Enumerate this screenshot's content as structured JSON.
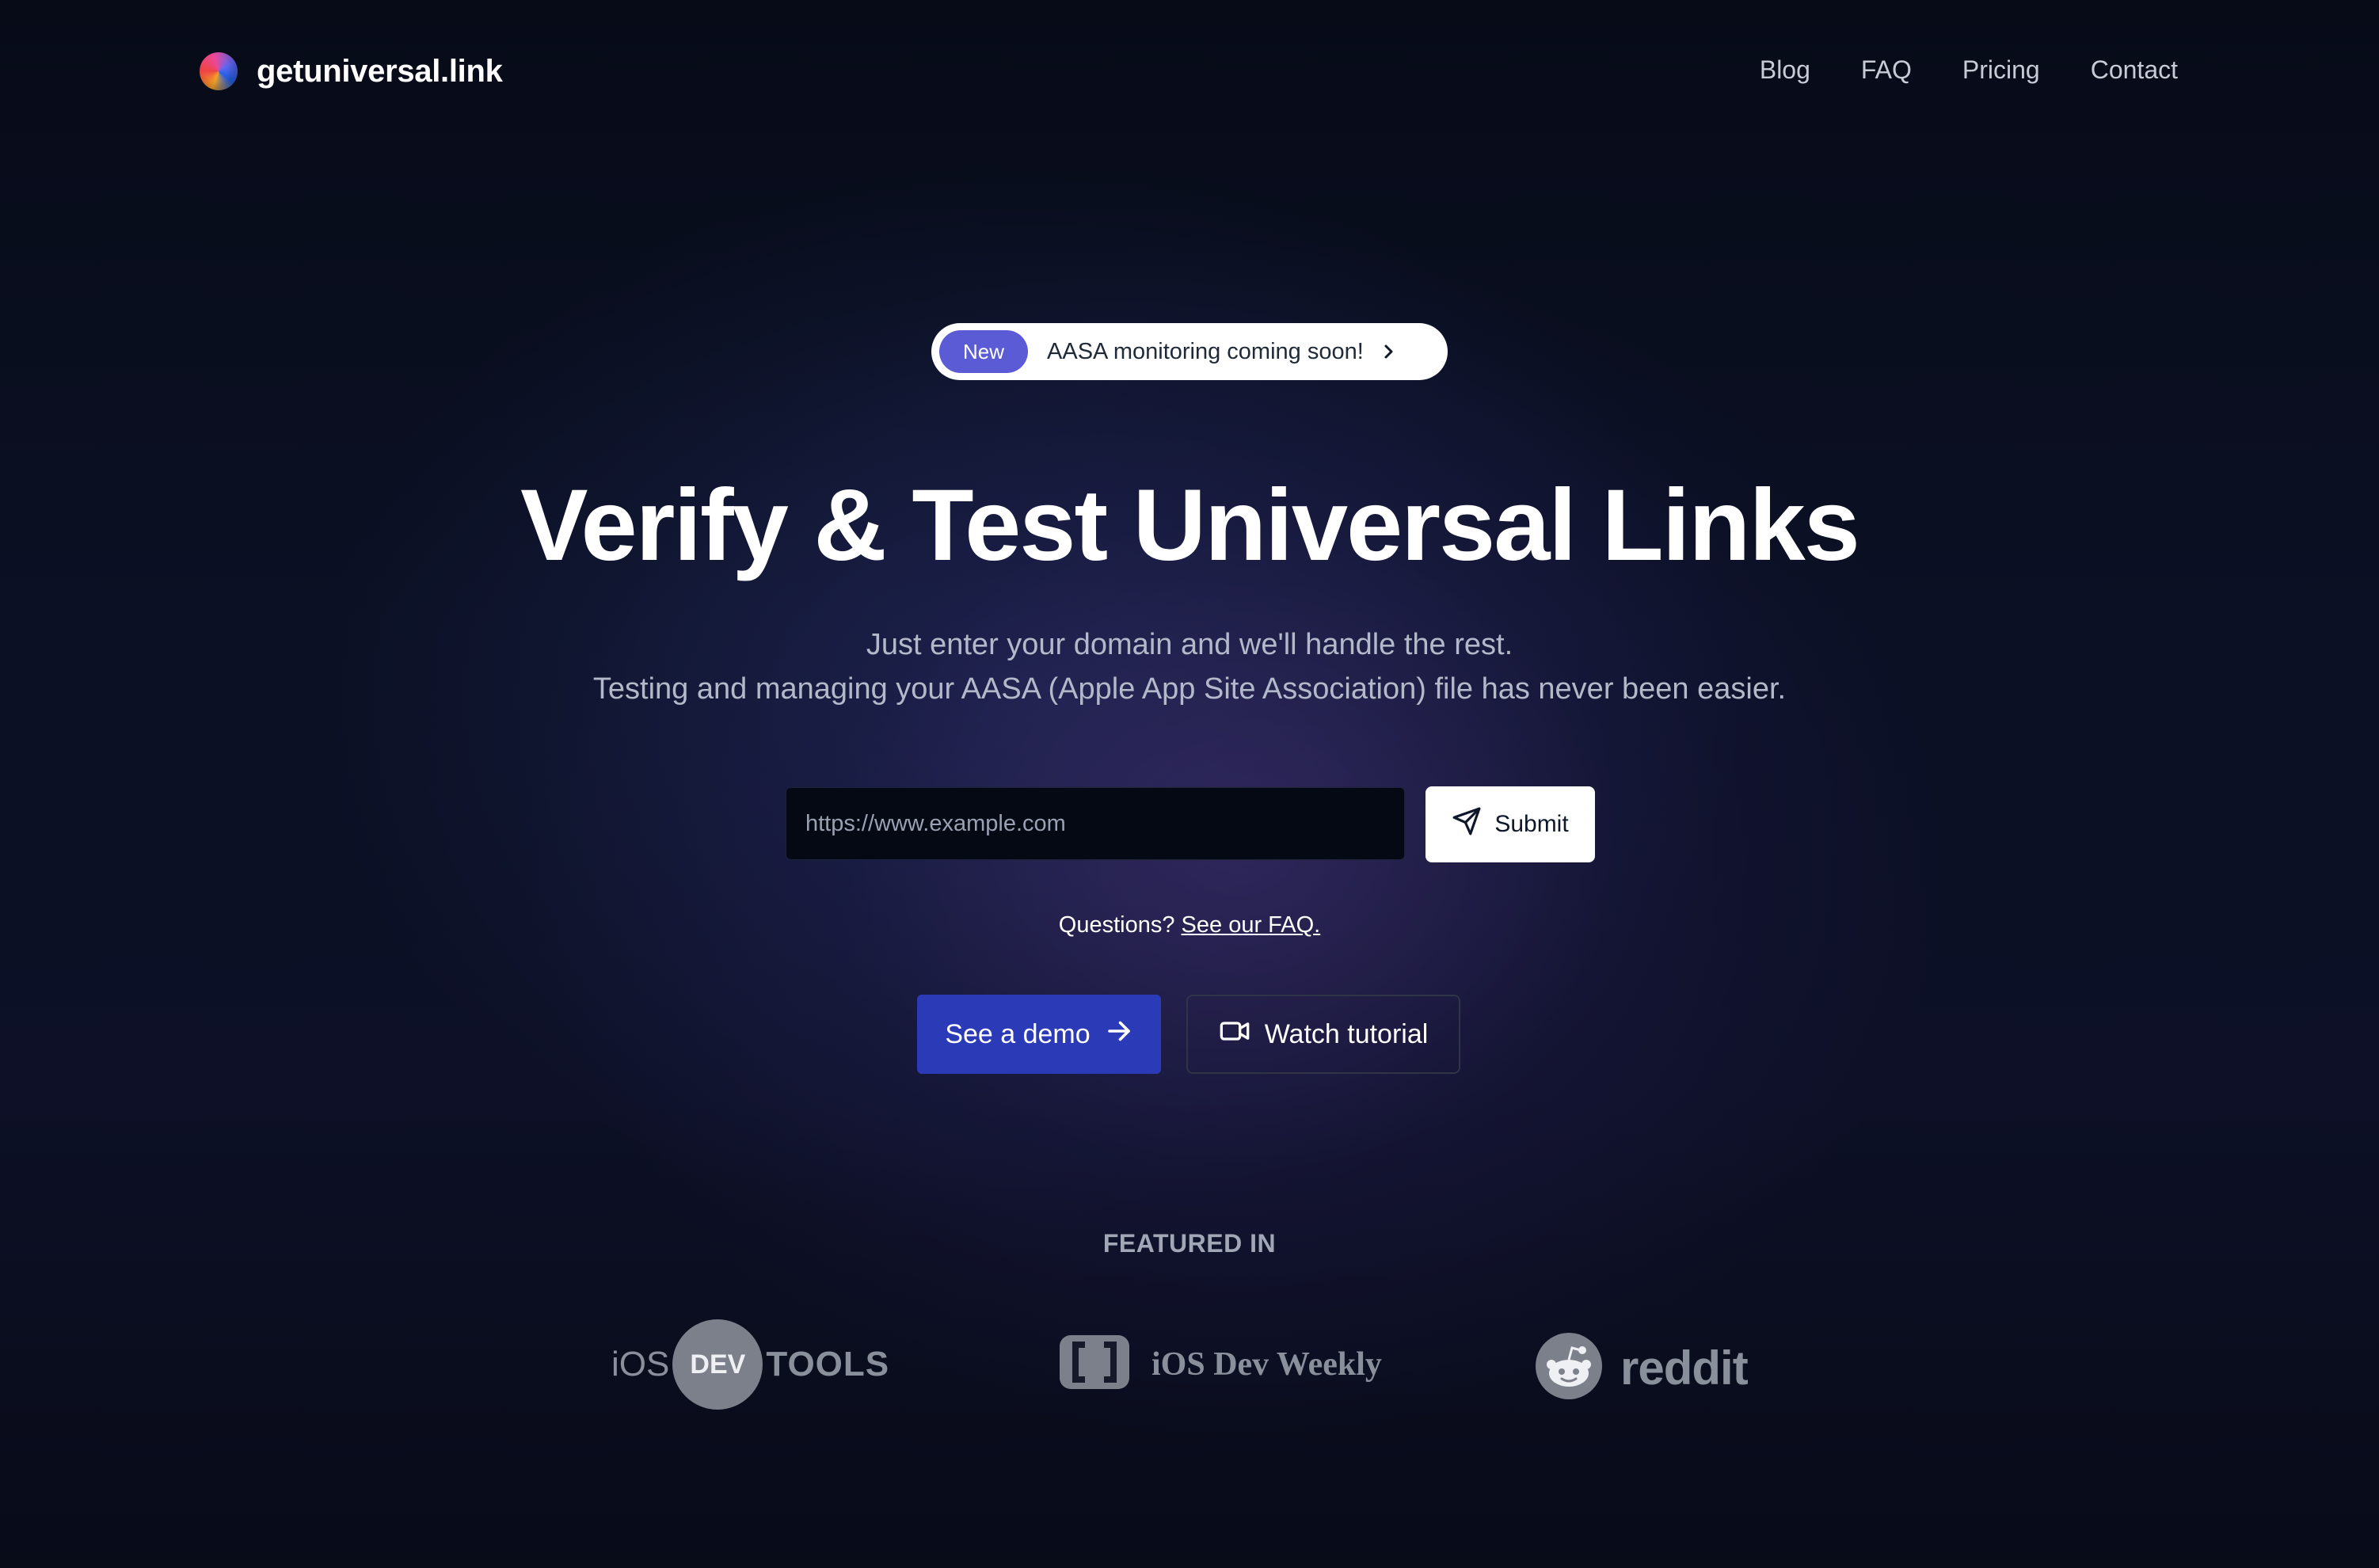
{
  "header": {
    "brand": "getuniversal.link",
    "nav": [
      {
        "label": "Blog"
      },
      {
        "label": "FAQ"
      },
      {
        "label": "Pricing"
      },
      {
        "label": "Contact"
      }
    ]
  },
  "announcement": {
    "badge": "New",
    "text": "AASA monitoring coming soon!"
  },
  "hero": {
    "title": "Verify & Test Universal Links",
    "subtitle_line1": "Just enter your domain and we'll handle the rest.",
    "subtitle_line2": "Testing and managing your AASA (Apple App Site Association) file has never been easier."
  },
  "form": {
    "url_placeholder": "https://www.example.com",
    "url_value": "",
    "submit_label": "Submit"
  },
  "faq": {
    "prefix": "Questions?",
    "link": "See our FAQ."
  },
  "cta": {
    "demo_label": "See a demo",
    "tutorial_label": "Watch tutorial"
  },
  "featured": {
    "title": "FEATURED IN",
    "items": [
      {
        "name": "iOS Dev Tools",
        "parts": [
          "iOS",
          "DEV",
          "TOOLS"
        ]
      },
      {
        "name": "iOS Dev Weekly",
        "text": "iOS Dev Weekly"
      },
      {
        "name": "reddit",
        "text": "reddit"
      }
    ]
  },
  "colors": {
    "background": "#070b18",
    "accent": "#2b3bb8",
    "badge": "#5b5bd6",
    "muted_logo": "#8a8f9c"
  },
  "icons": {
    "brand": "gradient-sphere-icon",
    "announcement": "chevron-right-icon",
    "submit": "send-icon",
    "demo": "arrow-right-icon",
    "tutorial": "video-camera-icon"
  }
}
